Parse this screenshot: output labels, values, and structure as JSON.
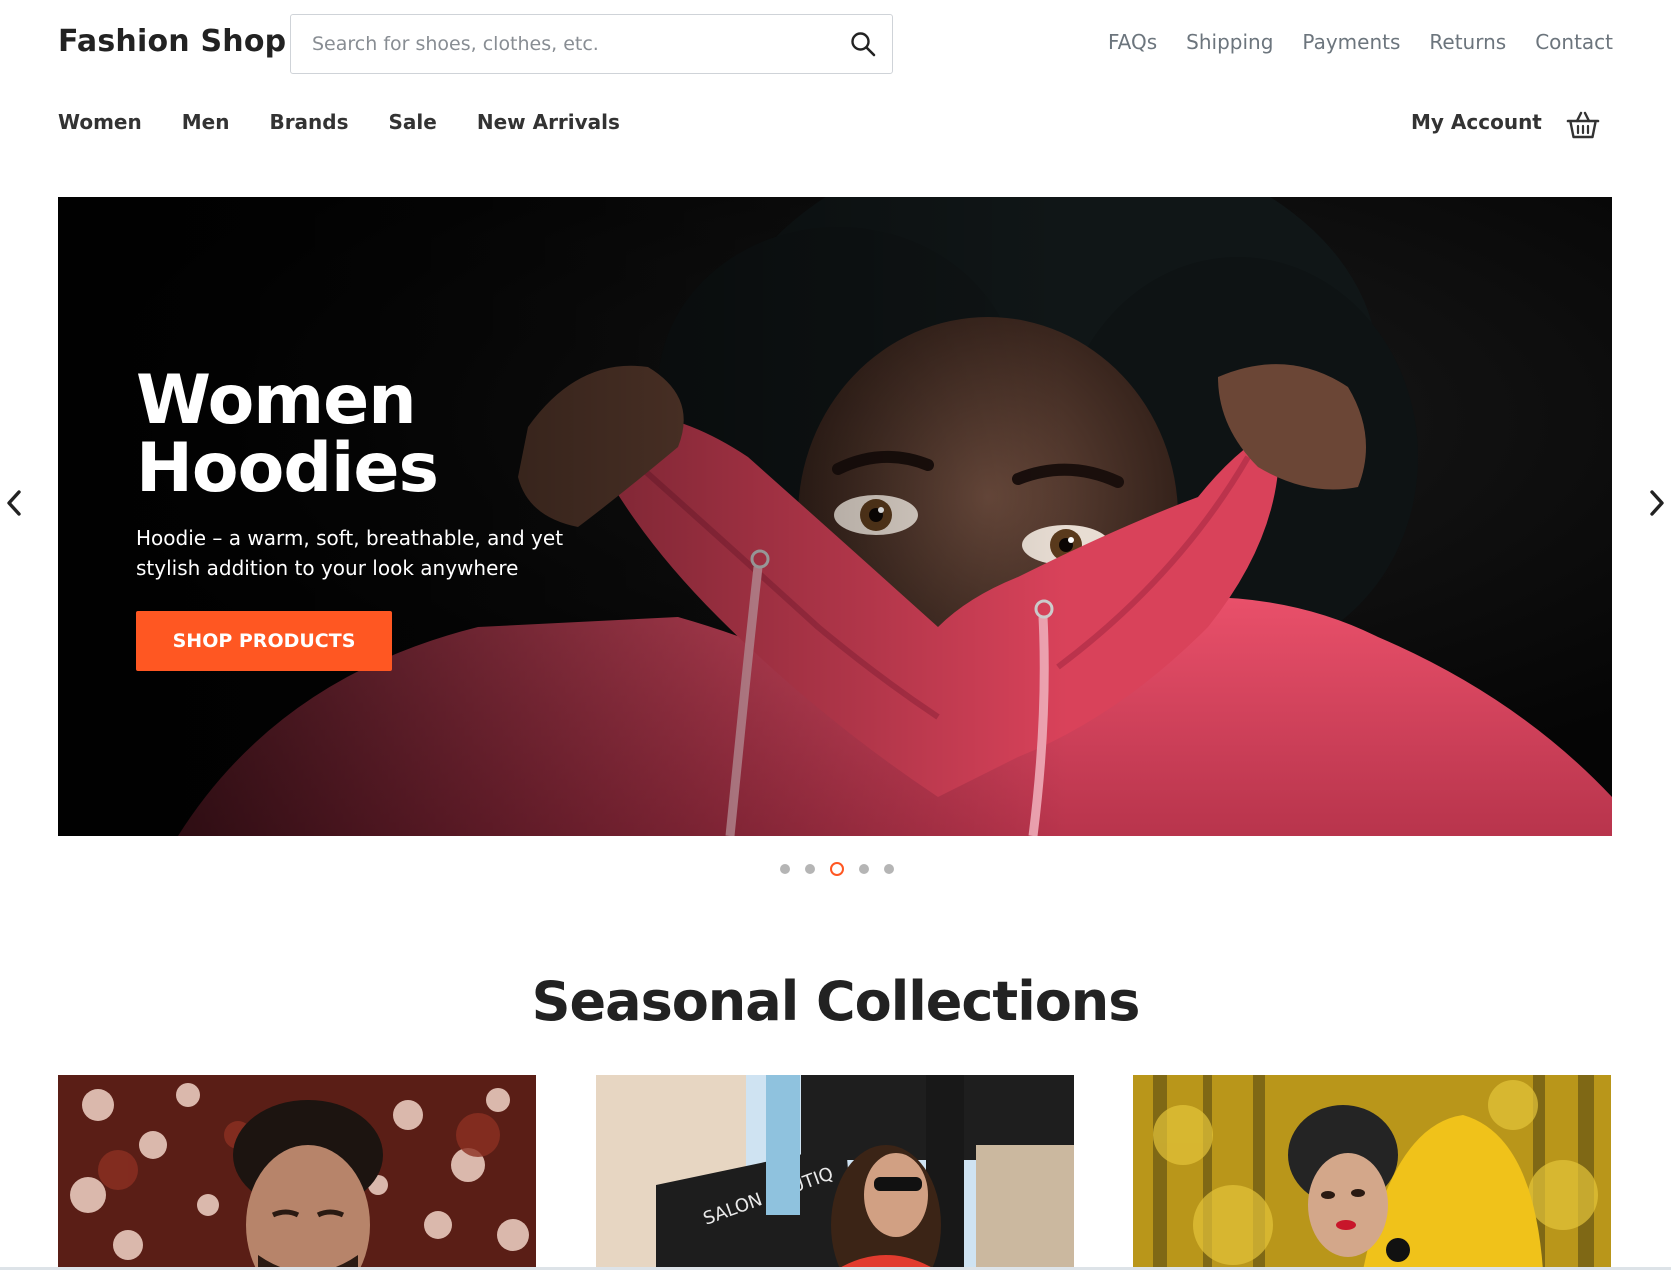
{
  "header": {
    "brand": "Fashion Shop",
    "search_placeholder": "Search for shoes, clothes, etc.",
    "util_links": [
      "FAQs",
      "Shipping",
      "Payments",
      "Returns",
      "Contact"
    ]
  },
  "nav": {
    "items": [
      "Women",
      "Men",
      "Brands",
      "Sale",
      "New Arrivals"
    ],
    "account": "My Account"
  },
  "hero": {
    "title_line1": "Women",
    "title_line2": "Hoodies",
    "description": "Hoodie – a warm, soft, breathable, and yet stylish addition to your look anywhere",
    "cta_label": "SHOP PRODUCTS",
    "slide_count": 5,
    "active_slide": 3
  },
  "collections": {
    "title": "Seasonal Collections"
  },
  "colors": {
    "accent": "#ff5722",
    "hoodie_pink": "#d9425a",
    "muted_text": "#6c757d",
    "dark_text": "#222222"
  },
  "icons": {
    "search": "search-icon",
    "cart": "basket-icon",
    "prev": "chevron-left-icon",
    "next": "chevron-right-icon"
  }
}
